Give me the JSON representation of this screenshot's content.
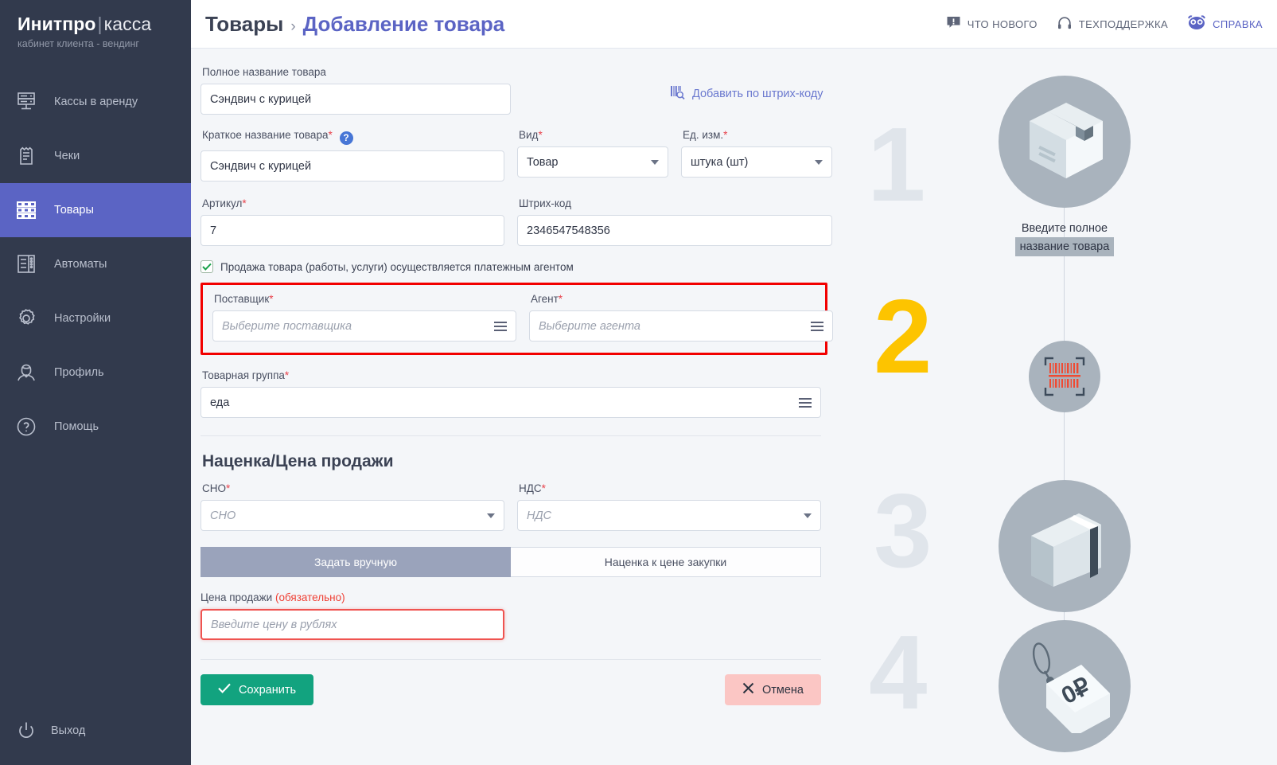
{
  "brand": {
    "name_strong": "Инитпро",
    "separator": "|",
    "name_light": "касса",
    "subtitle": "кабинет клиента - вендинг"
  },
  "sidebar": {
    "items": [
      {
        "label": "Кассы в аренду",
        "icon": "server-rack-icon",
        "active": false
      },
      {
        "label": "Чеки",
        "icon": "receipt-icon",
        "active": false
      },
      {
        "label": "Товары",
        "icon": "grid-products-icon",
        "active": true
      },
      {
        "label": "Автоматы",
        "icon": "vending-machine-icon",
        "active": false
      },
      {
        "label": "Настройки",
        "icon": "gear-icon",
        "active": false
      },
      {
        "label": "Профиль",
        "icon": "user-icon",
        "active": false
      },
      {
        "label": "Помощь",
        "icon": "question-circle-icon",
        "active": false
      }
    ],
    "logout": {
      "label": "Выход",
      "icon": "power-icon"
    }
  },
  "topbar": {
    "breadcrumb_root": "Товары",
    "breadcrumb_separator": "›",
    "breadcrumb_current": "Добавление товара",
    "links": [
      {
        "label": "ЧТО НОВОГО",
        "icon": "speech-bubble-alert-icon"
      },
      {
        "label": "ТЕХПОДДЕРЖКА",
        "icon": "headset-icon"
      },
      {
        "label": "СПРАВКА",
        "icon": "owl-icon"
      }
    ]
  },
  "form": {
    "full_name": {
      "label": "Полное название товара",
      "value": "Сэндвич с курицей"
    },
    "barcode_link": {
      "label": "Добавить по штрих-коду",
      "icon": "barcode-scan-icon"
    },
    "short_name": {
      "label": "Краткое название товара",
      "required_mark": "*",
      "help_icon": "question-help-icon",
      "value": "Сэндвич с курицей"
    },
    "kind": {
      "label": "Вид",
      "required_mark": "*",
      "value": "Товар"
    },
    "unit": {
      "label": "Ед. изм.",
      "required_mark": "*",
      "value": "штука (шт)"
    },
    "sku": {
      "label": "Артикул",
      "required_mark": "*",
      "value": "7"
    },
    "barcode": {
      "label": "Штрих-код",
      "value": "2346547548356"
    },
    "agent_checkbox": {
      "label": "Продажа товара (работы, услуги) осуществляется платежным агентом",
      "checked": true
    },
    "supplier": {
      "label": "Поставщик",
      "required_mark": "*",
      "placeholder": "Выберите поставщика",
      "value": ""
    },
    "agent": {
      "label": "Агент",
      "required_mark": "*",
      "placeholder": "Выберите агента",
      "value": ""
    },
    "product_group": {
      "label": "Товарная группа",
      "required_mark": "*",
      "value": "еда"
    },
    "markup_section_title": "Наценка/Цена продажи",
    "sno": {
      "label": "СНО",
      "required_mark": "*",
      "placeholder": "СНО",
      "value": ""
    },
    "nds": {
      "label": "НДС",
      "required_mark": "*",
      "placeholder": "НДС",
      "value": ""
    },
    "price_tabs": [
      {
        "label": "Задать вручную",
        "selected": true
      },
      {
        "label": "Наценка к цене закупки",
        "selected": false
      }
    ],
    "sale_price": {
      "label": "Цена продажи",
      "required_text": "(обязательно)",
      "placeholder": "Введите цену в рублях",
      "value": ""
    },
    "save_button": {
      "label": "Сохранить",
      "icon": "check-icon"
    },
    "cancel_button": {
      "label": "Отмена",
      "icon": "close-x-icon"
    }
  },
  "steps": [
    {
      "number": "1",
      "icon": "cardboard-box-icon",
      "caption_line1": "Введите полное",
      "caption_line2": "название товара",
      "highlight": false
    },
    {
      "number": "2",
      "icon": "barcode-scanner-icon",
      "caption_line1": "",
      "caption_line2": "",
      "highlight": true
    },
    {
      "number": "3",
      "icon": "folder-icon",
      "caption_line1": "",
      "caption_line2": "",
      "highlight": false
    },
    {
      "number": "4",
      "icon": "price-tag-icon",
      "caption_line1": "",
      "caption_line2": "",
      "highlight": false
    }
  ],
  "colors": {
    "sidebar_bg": "#323a4d",
    "sidebar_active": "#5b64c4",
    "accent_link": "#5b64c4",
    "required_red": "#e8424b",
    "error_border": "#f20000",
    "save_green": "#12a37f",
    "cancel_pink": "#fbc6c4",
    "step_gold": "#fdc400",
    "step_circle": "#a9b3bd",
    "page_bg": "#f4f6f9"
  }
}
